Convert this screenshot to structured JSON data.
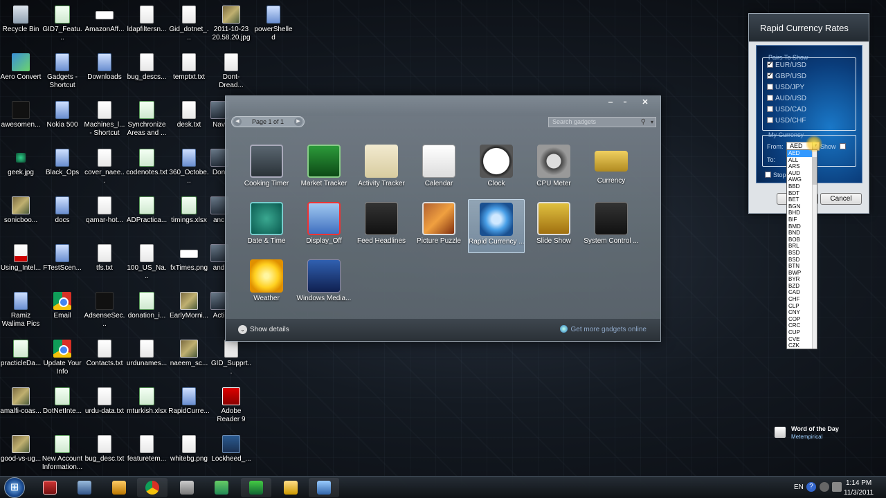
{
  "desktop_icons": [
    {
      "label": "Recycle Bin",
      "icon": "recycle-bin-icon"
    },
    {
      "label": "GID7_Featu...",
      "icon": "xlsx-file-icon"
    },
    {
      "label": "AmazonAff...",
      "icon": "image-file-icon"
    },
    {
      "label": "ldapfiltersn...",
      "icon": "text-file-icon"
    },
    {
      "label": "Gid_dotnet_...",
      "icon": "text-file-icon"
    },
    {
      "label": "2011-10-23 20.58.20.jpg",
      "icon": "photo-file-icon"
    },
    {
      "label": "powerShelled",
      "icon": "folder-icon"
    },
    {
      "label": "Aero Convert",
      "icon": "aero-app-icon"
    },
    {
      "label": "Gadgets - Shortcut",
      "icon": "folder-icon"
    },
    {
      "label": "Downloads",
      "icon": "folder-icon"
    },
    {
      "label": "bug_descs...",
      "icon": "text-file-icon"
    },
    {
      "label": "temptxt.txt",
      "icon": "text-file-icon"
    },
    {
      "label": "Dont-Dread...",
      "icon": "text-file-icon"
    },
    {
      "label": "awesomen...",
      "icon": "black-file-icon"
    },
    {
      "label": "Nokia 500",
      "icon": "folder-icon"
    },
    {
      "label": "Machines_l... - Shortcut",
      "icon": "text-file-icon"
    },
    {
      "label": "Synchronize Areas and ...",
      "icon": "xlsx-file-icon"
    },
    {
      "label": "desk.txt",
      "icon": "text-file-icon"
    },
    {
      "label": "Nav",
      "icon": "generic-file-icon"
    },
    {
      "label": "geek.jpg",
      "icon": "green-dot-icon"
    },
    {
      "label": "Black_Ops",
      "icon": "folder-icon"
    },
    {
      "label": "cover_naee...",
      "icon": "text-file-icon"
    },
    {
      "label": "codenotes.txt",
      "icon": "xlsx-file-icon"
    },
    {
      "label": "360_Octobe...",
      "icon": "folder-icon"
    },
    {
      "label": "Don",
      "icon": "generic-file-icon"
    },
    {
      "label": "sonicboo...",
      "icon": "photo-file-icon"
    },
    {
      "label": "docs",
      "icon": "folder-icon"
    },
    {
      "label": "qamar-hot...",
      "icon": "text-file-icon"
    },
    {
      "label": "ADPractica...",
      "icon": "xlsx-file-icon"
    },
    {
      "label": "timings.xlsx",
      "icon": "xlsx-file-icon"
    },
    {
      "label": "anc",
      "icon": "generic-file-icon"
    },
    {
      "label": "Using_Intel...",
      "icon": "pdf-file-icon"
    },
    {
      "label": "FTestScen...",
      "icon": "folder-icon"
    },
    {
      "label": "tfs.txt",
      "icon": "text-file-icon"
    },
    {
      "label": "100_US_Na...",
      "icon": "text-file-icon"
    },
    {
      "label": "fxTimes.png",
      "icon": "image-file-icon"
    },
    {
      "label": "and",
      "icon": "generic-file-icon"
    },
    {
      "label": "Ramiz Walima Pics",
      "icon": "folder-icon"
    },
    {
      "label": "Email",
      "icon": "chrome-icon"
    },
    {
      "label": "AdsenseSec...",
      "icon": "black-file-icon"
    },
    {
      "label": "donation_i...",
      "icon": "xlsx-file-icon"
    },
    {
      "label": "EarlyMorni...",
      "icon": "photo-file-icon"
    },
    {
      "label": "Acti",
      "icon": "generic-file-icon"
    },
    {
      "label": "practicleDa...",
      "icon": "xlsx-file-icon"
    },
    {
      "label": "Update Your Info",
      "icon": "chrome-icon"
    },
    {
      "label": "Contacts.txt",
      "icon": "text-file-icon"
    },
    {
      "label": "urdunames...",
      "icon": "text-file-icon"
    },
    {
      "label": "naeem_sc...",
      "icon": "photo-file-icon"
    },
    {
      "label": "GID_Supprt...",
      "icon": "text-file-icon"
    },
    {
      "label": "amalfi-coas...",
      "icon": "photo-file-icon"
    },
    {
      "label": "DotNetInte...",
      "icon": "word-file-icon"
    },
    {
      "label": "urdu-data.txt",
      "icon": "text-file-icon"
    },
    {
      "label": "mturkish.xlsx",
      "icon": "xlsx-file-icon"
    },
    {
      "label": "RapidCurre...",
      "icon": "folder-icon"
    },
    {
      "label": "Adobe Reader 9",
      "icon": "acrobat-icon"
    },
    {
      "label": "good-vs-ug...",
      "icon": "photo-file-icon"
    },
    {
      "label": "New Account Information...",
      "icon": "word-file-icon"
    },
    {
      "label": "bug_desc.txt",
      "icon": "text-file-icon"
    },
    {
      "label": "featuretem...",
      "icon": "text-file-icon"
    },
    {
      "label": "whitebg.png",
      "icon": "text-file-icon"
    },
    {
      "label": "Lockheed_...",
      "icon": "plane-icon"
    }
  ],
  "gallery": {
    "pager": "Page 1 of 1",
    "search_placeholder": "Search gadgets",
    "gadgets": [
      {
        "label": "Cooking Timer",
        "cls": "g-cooking",
        "icon": "cooking-timer-icon"
      },
      {
        "label": "Market Tracker",
        "cls": "g-market",
        "icon": "market-tracker-icon"
      },
      {
        "label": "Activity Tracker",
        "cls": "g-activity",
        "icon": "activity-tracker-icon"
      },
      {
        "label": "Calendar",
        "cls": "g-calendar",
        "icon": "calendar-icon"
      },
      {
        "label": "Clock",
        "cls": "g-clock",
        "icon": "clock-icon"
      },
      {
        "label": "CPU Meter",
        "cls": "g-cpu",
        "icon": "cpu-meter-icon"
      },
      {
        "label": "Currency",
        "cls": "g-currency",
        "icon": "currency-icon"
      },
      {
        "label": "Date & Time",
        "cls": "g-date",
        "icon": "date-time-icon"
      },
      {
        "label": "Display_Off",
        "cls": "g-display",
        "icon": "display-off-icon"
      },
      {
        "label": "Feed Headlines",
        "cls": "g-feed",
        "icon": "feed-headlines-icon"
      },
      {
        "label": "Picture Puzzle",
        "cls": "g-puzzle",
        "icon": "picture-puzzle-icon"
      },
      {
        "label": "Rapid Currency ...",
        "cls": "g-rapid",
        "icon": "rapid-currency-icon",
        "selected": true
      },
      {
        "label": "Slide Show",
        "cls": "g-slide",
        "icon": "slide-show-icon"
      },
      {
        "label": "System Control ...",
        "cls": "g-sysctl",
        "icon": "system-control-icon"
      },
      {
        "label": "Weather",
        "cls": "g-weather",
        "icon": "weather-icon"
      },
      {
        "label": "Windows Media...",
        "cls": "g-media",
        "icon": "windows-media-icon"
      }
    ],
    "show_details": "Show details",
    "get_more": "Get more gadgets online"
  },
  "rapid_currency": {
    "title": "Rapid Currency Rates",
    "pairs_legend": "Pairs To Show",
    "pairs": [
      {
        "label": "EUR/USD",
        "checked": true
      },
      {
        "label": "GBP/USD",
        "checked": true
      },
      {
        "label": "USD/JPY",
        "checked": false
      },
      {
        "label": "AUD/USD",
        "checked": false
      },
      {
        "label": "USD/CAD",
        "checked": false
      },
      {
        "label": "USD/CHF",
        "checked": false
      }
    ],
    "my_currency_legend": "My Currency",
    "from_label": "From:",
    "to_label": "To:",
    "from_value": "AED",
    "show_label": "Show",
    "stop_label": "Stop",
    "ok_label": "OK",
    "cancel_label": "Cancel",
    "currency_options": [
      "AED",
      "ALL",
      "ARS",
      "AUD",
      "AWG",
      "BBD",
      "BDT",
      "BET",
      "BGN",
      "BHD",
      "BIF",
      "BMD",
      "BND",
      "BOB",
      "BRL",
      "BSD",
      "BSD",
      "BTN",
      "BWP",
      "BYR",
      "BZD",
      "CAD",
      "CHF",
      "CLP",
      "CNY",
      "COP",
      "CRC",
      "CUP",
      "CVE",
      "CZK"
    ]
  },
  "word_of_day": {
    "title": "Word of the Day",
    "word": "Metempirical"
  },
  "taskbar": {
    "language": "EN",
    "time": "1:14 PM",
    "date": "11/3/2011"
  }
}
